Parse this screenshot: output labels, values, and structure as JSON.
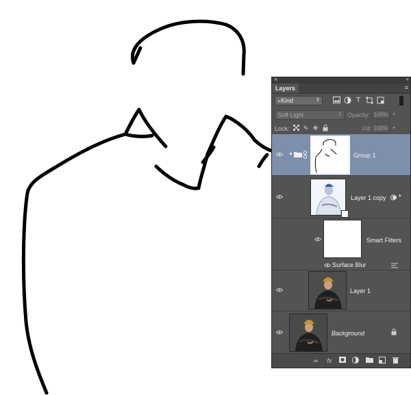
{
  "panel": {
    "close_glyph": "×",
    "collapse_glyph": "‹‹",
    "tab_label": "Layers",
    "menu_glyph": "≡"
  },
  "filter": {
    "kind_label": "Kind",
    "kind_prefix": "⌕",
    "icons": [
      "image-filter-icon",
      "adjustment-filter-icon",
      "type-filter-icon",
      "shape-filter-icon",
      "smart-object-filter-icon"
    ],
    "type_glyph": "T"
  },
  "blend": {
    "mode": "Soft Light",
    "opacity_label": "Opacity:",
    "opacity_value": "100%",
    "fill_label": "Fill:",
    "fill_value": "100%"
  },
  "lock": {
    "label": "Lock:",
    "icons": [
      "lock-transparent-icon",
      "lock-image-icon",
      "lock-position-icon",
      "lock-all-icon"
    ]
  },
  "layers": [
    {
      "name": "Group 1",
      "selected": true
    },
    {
      "name": "Layer 1 copy",
      "selected": false
    },
    {
      "name": "Smart Filters",
      "selected": false
    },
    {
      "name": "Surface Blur",
      "selected": false
    },
    {
      "name": "Layer 1",
      "selected": false
    },
    {
      "name": "Background",
      "selected": false
    }
  ],
  "colors": {
    "panel_bg": "#535353",
    "selected_row": "#7d8fab",
    "outline_stroke": "#000000"
  },
  "bottom_icons": [
    "link-layers-icon",
    "fx-icon",
    "add-mask-icon",
    "adjustment-layer-icon",
    "new-group-icon",
    "new-layer-icon",
    "trash-icon"
  ],
  "fx_label": "fx"
}
